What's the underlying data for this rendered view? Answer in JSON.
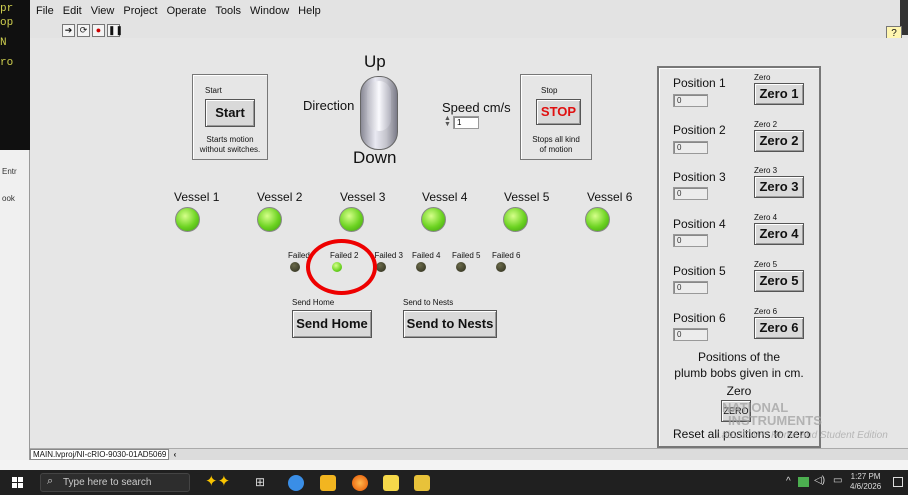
{
  "terminal": {
    "lines": [
      "pr",
      "op",
      "N",
      "ro"
    ]
  },
  "left_labels": {
    "entry": "Entr",
    "book": "ook"
  },
  "menubar": [
    "File",
    "Edit",
    "View",
    "Project",
    "Operate",
    "Tools",
    "Window",
    "Help"
  ],
  "toolbar": {
    "run_icon": "run-arrow-icon",
    "run_continuous_icon": "run-continuous-icon",
    "abort_icon": "abort-icon",
    "pause_icon": "pause-icon",
    "help_glyph": "?"
  },
  "start_box": {
    "caption": "Start",
    "button": "Start",
    "desc1": "Starts motion",
    "desc2": "without switches."
  },
  "direction": {
    "up": "Up",
    "label": "Direction",
    "down": "Down"
  },
  "speed": {
    "label": "Speed cm/s",
    "value": "1"
  },
  "stop_box": {
    "caption": "Stop",
    "button": "STOP",
    "desc1": "Stops all kind",
    "desc2": "of motion"
  },
  "vessels": [
    "Vessel 1",
    "Vessel 2",
    "Vessel 3",
    "Vessel 4",
    "Vessel 5",
    "Vessel 6"
  ],
  "failed": [
    {
      "label": "Failed 1",
      "on": false
    },
    {
      "label": "Failed 2",
      "on": true
    },
    {
      "label": "Failed 3",
      "on": false
    },
    {
      "label": "Failed 4",
      "on": false
    },
    {
      "label": "Failed 5",
      "on": false
    },
    {
      "label": "Failed 6",
      "on": false
    }
  ],
  "send_home": {
    "caption": "Send Home",
    "button": "Send Home"
  },
  "send_nests": {
    "caption": "Send to Nests",
    "button": "Send to Nests"
  },
  "positions": [
    {
      "label": "Position 1",
      "value": "0",
      "zero_caption": "Zero",
      "zero_button": "Zero 1"
    },
    {
      "label": "Position 2",
      "value": "0",
      "zero_caption": "Zero 2",
      "zero_button": "Zero 2"
    },
    {
      "label": "Position 3",
      "value": "0",
      "zero_caption": "Zero 3",
      "zero_button": "Zero 3"
    },
    {
      "label": "Position 4",
      "value": "0",
      "zero_caption": "Zero 4",
      "zero_button": "Zero 4"
    },
    {
      "label": "Position 5",
      "value": "0",
      "zero_caption": "Zero 5",
      "zero_button": "Zero 5"
    },
    {
      "label": "Position 6",
      "value": "0",
      "zero_caption": "Zero 6",
      "zero_button": "Zero 6"
    }
  ],
  "positions_note1": "Positions of the",
  "positions_note2": "plumb bobs given in cm.",
  "zero_all": {
    "caption": "Zero",
    "button": "ZERO",
    "desc": "Reset all positions to zero"
  },
  "watermark": {
    "line1": "NATIONAL",
    "line2": "INSTRUMENTS",
    "line3": "LabVIEW™ Home and Student Edition"
  },
  "statusbar": {
    "path": "MAIN.lvproj/NI-cRIO-9030-01AD5069"
  },
  "highlight": {
    "color": "#ee0000"
  },
  "taskbar": {
    "search_placeholder": "Type here to search",
    "time": "1:27 PM",
    "date": "4/6/2026"
  }
}
